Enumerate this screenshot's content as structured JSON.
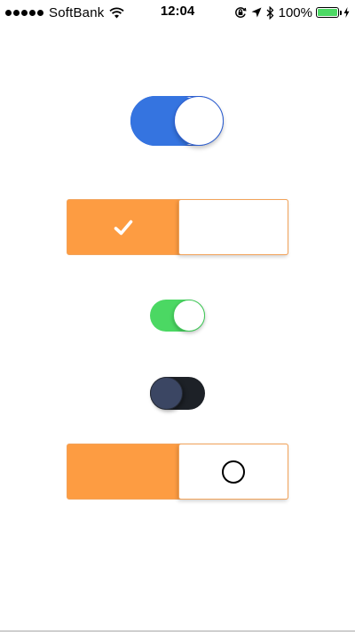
{
  "status_bar": {
    "carrier": "SoftBank",
    "time": "12:04",
    "battery_percent": "100%",
    "battery_level": 1.0,
    "icons": [
      "signal-dots-icon",
      "wifi-icon",
      "orientation-lock-icon",
      "location-arrow-icon",
      "bluetooth-icon",
      "battery-icon",
      "charging-bolt-icon"
    ]
  },
  "toggles": [
    {
      "style": "blue-rounded",
      "state": "on",
      "accent": "#3574e0"
    },
    {
      "style": "orange-rect-check",
      "state": "on",
      "accent": "#fd9c42",
      "icon": "checkmark-icon"
    },
    {
      "style": "green-small",
      "state": "on",
      "accent": "#4bd863"
    },
    {
      "style": "dark",
      "state": "off",
      "accent": "#1d2127",
      "knob_color": "#3b4663"
    },
    {
      "style": "orange-rect-circle",
      "state": "off",
      "accent": "#fd9c42",
      "icon": "circle-icon"
    }
  ]
}
